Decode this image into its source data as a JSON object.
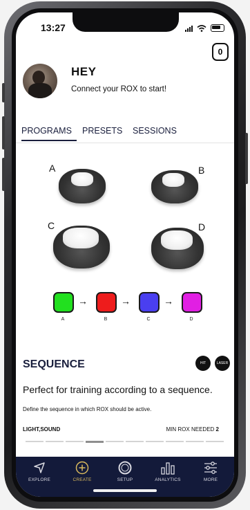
{
  "status": {
    "time": "13:27"
  },
  "header": {
    "counter": "0",
    "greeting": "HEY",
    "subtitle": "Connect your ROX to start!"
  },
  "tabs": [
    {
      "label": "PROGRAMS",
      "active": true
    },
    {
      "label": "PRESETS",
      "active": false
    },
    {
      "label": "SESSIONS",
      "active": false
    }
  ],
  "rox_units": [
    {
      "label": "A"
    },
    {
      "label": "B"
    },
    {
      "label": "C"
    },
    {
      "label": "D"
    }
  ],
  "sequence_preview": {
    "steps": [
      {
        "label": "A",
        "color": "#22e01f"
      },
      {
        "label": "B",
        "color": "#ee1c1c"
      },
      {
        "label": "C",
        "color": "#4a3ff0"
      },
      {
        "label": "D",
        "color": "#e11fe3"
      }
    ],
    "arrow": "→"
  },
  "program": {
    "title": "SEQUENCE",
    "modes": [
      {
        "label": "HIT"
      },
      {
        "label": "LASER"
      }
    ],
    "description": "Perfect for training according to a sequence.",
    "note": "Define the sequence in which ROX should be active.",
    "features": "LIGHT,SOUND",
    "min_rox_label": "MIN ROX NEEDED",
    "min_rox_value": "2",
    "page_indicator": {
      "total": 10,
      "current": 4
    }
  },
  "bottom_nav": [
    {
      "label": "EXPLORE",
      "icon": "explore-icon",
      "active": false
    },
    {
      "label": "CREATE",
      "icon": "create-plus-icon",
      "active": true
    },
    {
      "label": "SETUP",
      "icon": "setup-ring-icon",
      "active": false
    },
    {
      "label": "ANALYTICS",
      "icon": "analytics-bars-icon",
      "active": false
    },
    {
      "label": "MORE",
      "icon": "sliders-icon",
      "active": false
    }
  ],
  "colors": {
    "navy": "#131a3a",
    "active_nav": "#d9b95e"
  }
}
